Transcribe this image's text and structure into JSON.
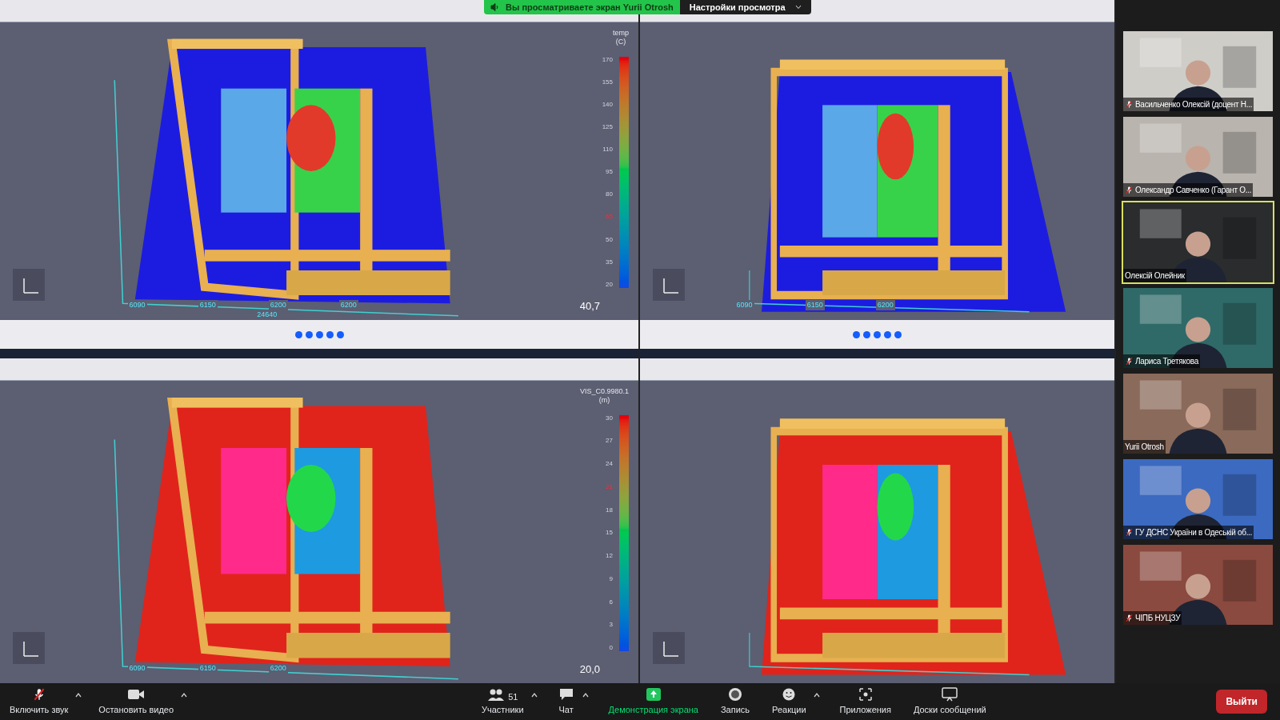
{
  "banner": {
    "text": "Вы просматриваете экран Yurii Otrosh",
    "settings": "Настройки просмотра"
  },
  "views": [
    {
      "kind": "temp",
      "legend": {
        "title": [
          "temp",
          "(C)"
        ],
        "ticks": [
          {
            "label": "170",
            "highlight": false
          },
          {
            "label": "155",
            "highlight": false
          },
          {
            "label": "140",
            "highlight": false
          },
          {
            "label": "125",
            "highlight": false
          },
          {
            "label": "110",
            "highlight": false
          },
          {
            "label": "95",
            "highlight": false
          },
          {
            "label": "80",
            "highlight": false
          },
          {
            "label": "65",
            "highlight": true
          },
          {
            "label": "50",
            "highlight": false
          },
          {
            "label": "35",
            "highlight": false
          },
          {
            "label": "20",
            "highlight": false
          }
        ]
      },
      "value": "40,7",
      "dims": [
        "6090",
        "6150",
        "6200",
        "6200"
      ],
      "total": "24640"
    },
    {
      "kind": "temp",
      "dims": [
        "6090",
        "6150",
        "6200"
      ]
    },
    {
      "kind": "vis",
      "legend": {
        "title": [
          "VIS_C0.9980.1",
          "(m)"
        ],
        "ticks": [
          {
            "label": "30",
            "highlight": false
          },
          {
            "label": "27",
            "highlight": false
          },
          {
            "label": "24",
            "highlight": false
          },
          {
            "label": "21",
            "highlight": true
          },
          {
            "label": "18",
            "highlight": false
          },
          {
            "label": "15",
            "highlight": false
          },
          {
            "label": "12",
            "highlight": false
          },
          {
            "label": "9",
            "highlight": false
          },
          {
            "label": "6",
            "highlight": false
          },
          {
            "label": "3",
            "highlight": false
          },
          {
            "label": "0",
            "highlight": false
          }
        ]
      },
      "value": "20,0",
      "dims": [
        "6090",
        "6150",
        "6200"
      ]
    },
    {
      "kind": "vis"
    }
  ],
  "participants": [
    {
      "name": "Васильченко Олексій (доцент Н...",
      "muted": true,
      "speaking": false
    },
    {
      "name": "Олександр Савченко (Гарант О...",
      "muted": true,
      "speaking": false
    },
    {
      "name": "Олексій Олейник",
      "muted": false,
      "speaking": true
    },
    {
      "name": "Лариса Третякова",
      "muted": true,
      "speaking": false
    },
    {
      "name": "Yurii Otrosh",
      "muted": false,
      "speaking": false
    },
    {
      "name": "ГУ ДСНС України в Одеській об...",
      "muted": true,
      "speaking": false
    },
    {
      "name": "ЧІПБ НУЦЗУ",
      "muted": true,
      "speaking": false
    }
  ],
  "toolbar": {
    "left": [
      {
        "kind": "mic",
        "label": "Включить звук",
        "muted": true
      },
      {
        "kind": "video",
        "label": "Остановить видео"
      }
    ],
    "center": [
      {
        "kind": "people",
        "label": "Участники",
        "count": "51"
      },
      {
        "kind": "chat",
        "label": "Чат"
      },
      {
        "kind": "share",
        "label": "Демонстрация экрана"
      },
      {
        "kind": "record",
        "label": "Запись"
      },
      {
        "kind": "reactions",
        "label": "Реакции"
      },
      {
        "kind": "apps",
        "label": "Приложения"
      },
      {
        "kind": "board",
        "label": "Доски сообщений"
      }
    ],
    "leave": "Выйти"
  }
}
